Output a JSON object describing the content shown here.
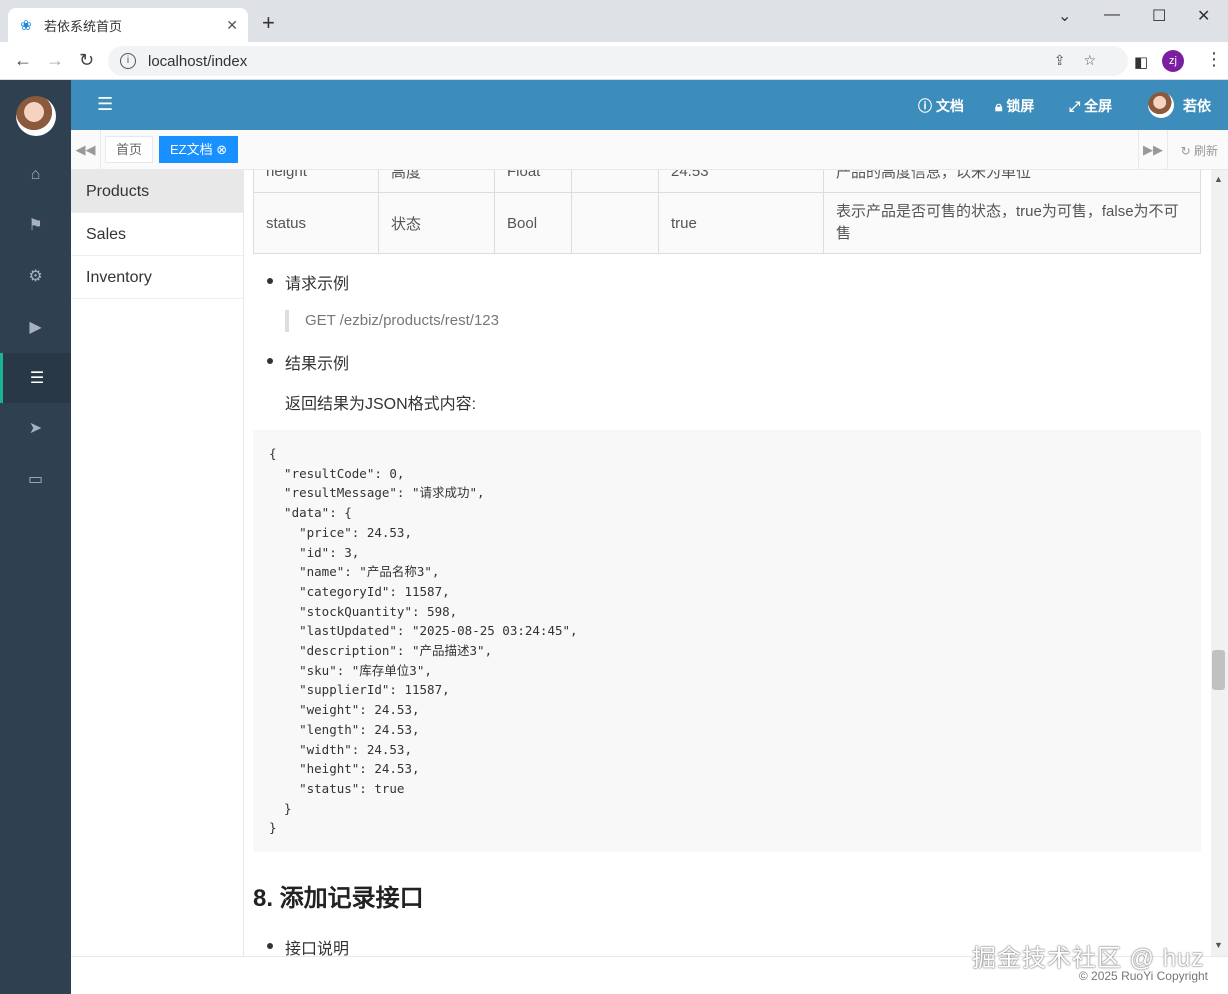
{
  "browser": {
    "tab_title": "若依系统首页",
    "url": "localhost/index",
    "profile_initials": "zj"
  },
  "topnav": {
    "docs": "文档",
    "lock": "锁屏",
    "fullscreen": "全屏",
    "user": "若依"
  },
  "pagetabs": {
    "home": "首页",
    "active": "EZ文档",
    "refresh": "刷新"
  },
  "menu": [
    "Products",
    "Sales",
    "Inventory"
  ],
  "table": {
    "rows": [
      [
        "height",
        "高度",
        "Float",
        "",
        "24.53",
        "产品的高度信息，以米为单位"
      ],
      [
        "status",
        "状态",
        "Bool",
        "",
        "true",
        "表示产品是否可售的状态，true为可售，false为不可售"
      ]
    ]
  },
  "request_example": {
    "label": "请求示例",
    "value": "GET /ezbiz/products/rest/123"
  },
  "result_example": {
    "label": "结果示例",
    "desc": "返回结果为JSON格式内容:"
  },
  "code": "{\n  \"resultCode\": 0,\n  \"resultMessage\": \"请求成功\",\n  \"data\": {\n    \"price\": 24.53,\n    \"id\": 3,\n    \"name\": \"产品名称3\",\n    \"categoryId\": 11587,\n    \"stockQuantity\": 598,\n    \"lastUpdated\": \"2025-08-25 03:24:45\",\n    \"description\": \"产品描述3\",\n    \"sku\": \"库存单位3\",\n    \"supplierId\": 11587,\n    \"weight\": 24.53,\n    \"length\": 24.53,\n    \"width\": 24.53,\n    \"height\": 24.53,\n    \"status\": true\n  }\n}",
  "section_heading": "8. 添加记录接口",
  "next_bullet": "接口说明",
  "footer": "© 2025 RuoYi Copyright",
  "watermark": "掘金技术社区 @ huz"
}
